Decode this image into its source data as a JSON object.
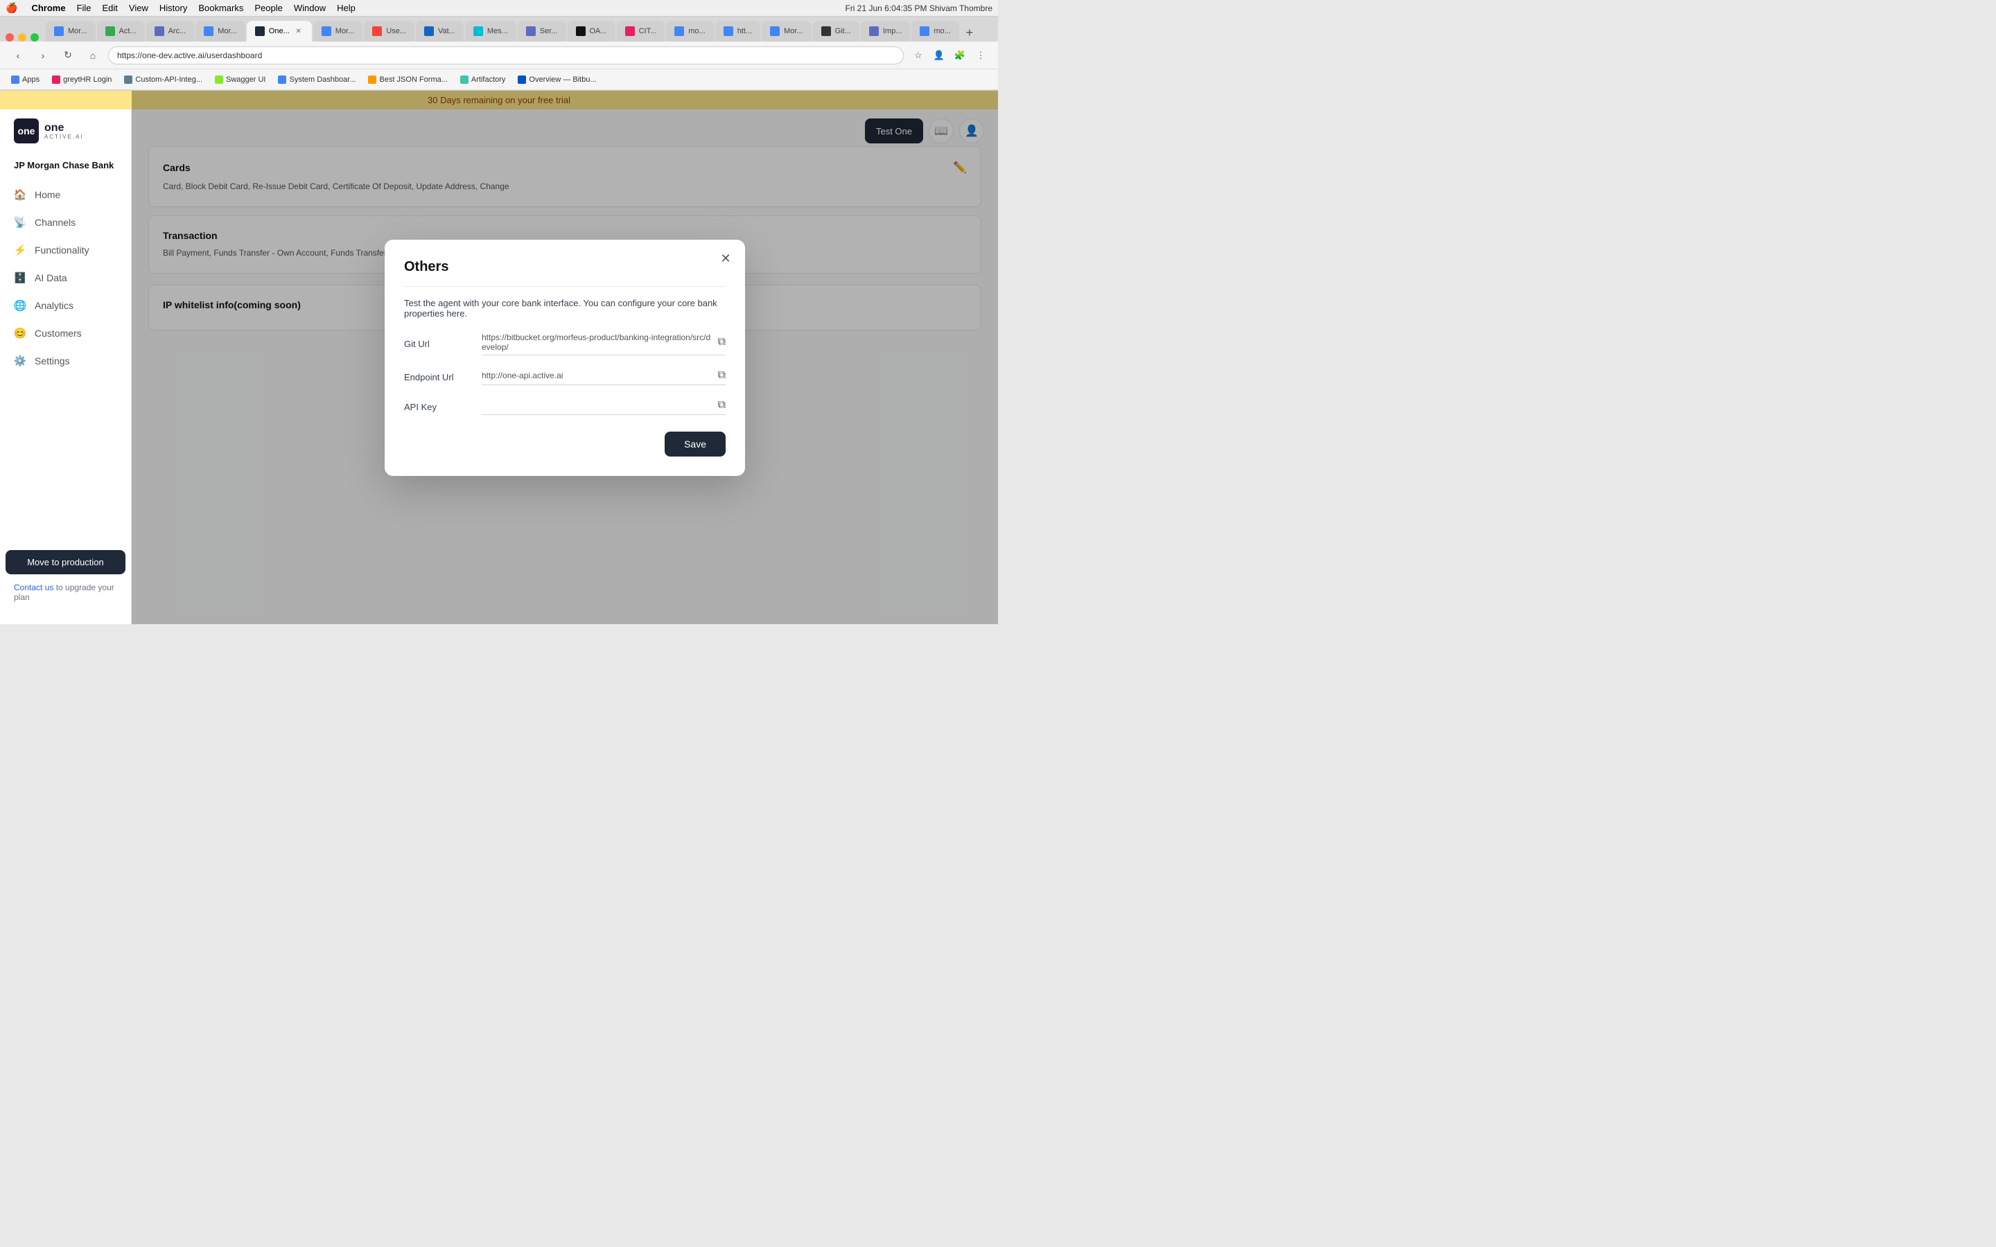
{
  "menubar": {
    "apple": "🍎",
    "items": [
      "Chrome",
      "File",
      "Edit",
      "View",
      "History",
      "Bookmarks",
      "People",
      "Window",
      "Help"
    ],
    "right": "Fri 21 Jun  6:04:35 PM  Shivam Thombre"
  },
  "tabs": [
    {
      "label": "Mor...",
      "active": false
    },
    {
      "label": "Act...",
      "active": false
    },
    {
      "label": "Arc...",
      "active": false
    },
    {
      "label": "Mor...",
      "active": false
    },
    {
      "label": "One...",
      "active": true
    },
    {
      "label": "Mor...",
      "active": false
    },
    {
      "label": "Use...",
      "active": false
    },
    {
      "label": "Vat...",
      "active": false
    },
    {
      "label": "Mes...",
      "active": false
    },
    {
      "label": "Ser...",
      "active": false
    },
    {
      "label": "OA...",
      "active": false
    },
    {
      "label": "CIT...",
      "active": false
    },
    {
      "label": "mo...",
      "active": false
    },
    {
      "label": "htt...",
      "active": false
    },
    {
      "label": "Mor...",
      "active": false
    },
    {
      "label": "Git...",
      "active": false
    },
    {
      "label": "Imp...",
      "active": false
    },
    {
      "label": "mo...",
      "active": false
    }
  ],
  "address_bar": "https://one-dev.active.ai/userdashboard",
  "bookmarks": [
    "Apps",
    "greytHR Login",
    "Custom-API-Integ...",
    "Swagger UI",
    "System Dashboar...",
    "Best JSON Forma...",
    "Artifactory",
    "Overview — Bitbu..."
  ],
  "trial_banner": "30 Days remaining on your free trial",
  "sidebar": {
    "logo_text": "one",
    "logo_sub": "ACTIVE.AI",
    "company": "JP Morgan Chase Bank",
    "nav_items": [
      {
        "icon": "🏠",
        "label": "Home",
        "active": false
      },
      {
        "icon": "📡",
        "label": "Channels",
        "active": false
      },
      {
        "icon": "⚡",
        "label": "Functionality",
        "active": false
      },
      {
        "icon": "🗄️",
        "label": "AI Data",
        "active": false
      },
      {
        "icon": "🌐",
        "label": "Analytics",
        "active": false
      },
      {
        "icon": "😊",
        "label": "Customers",
        "active": false
      },
      {
        "icon": "⚙️",
        "label": "Settings",
        "active": false
      }
    ],
    "move_to_production": "Move to production",
    "contact_text": "Contact us",
    "contact_suffix": " to upgrade your plan"
  },
  "main_content": {
    "sections": [
      {
        "title": "Transaction",
        "text": "Bill Payment, Funds Transfer - Own Account, Funds Transfer - Within Bank, Bill Payment, Pay Credit Card Bill, EMI Conversion,"
      },
      {
        "title": "IP whitelist info(coming soon)",
        "text": ""
      }
    ],
    "cards_text": "Card, Block Debit Card, Re-Issue Debit Card, Certificate Of Deposit, Update Address, Change"
  },
  "modal": {
    "title": "Others",
    "description": "Test the agent with your core bank interface. You can configure your core bank properties here.",
    "fields": [
      {
        "label": "Git Url",
        "value": "https://bitbucket.org/morfeus-product/banking-integration/src/develop/",
        "has_copy": true
      },
      {
        "label": "Endpoint Url",
        "value": "http://one-api.active.ai",
        "has_copy": true
      },
      {
        "label": "API Key",
        "value": "",
        "has_copy": true
      }
    ],
    "save_button": "Save",
    "close_icon": "✕"
  },
  "top_buttons": {
    "test_one": "Test One",
    "book_icon": "📖",
    "user_icon": "👤"
  },
  "icons": {
    "copy": "⧉",
    "edit": "✏️"
  }
}
